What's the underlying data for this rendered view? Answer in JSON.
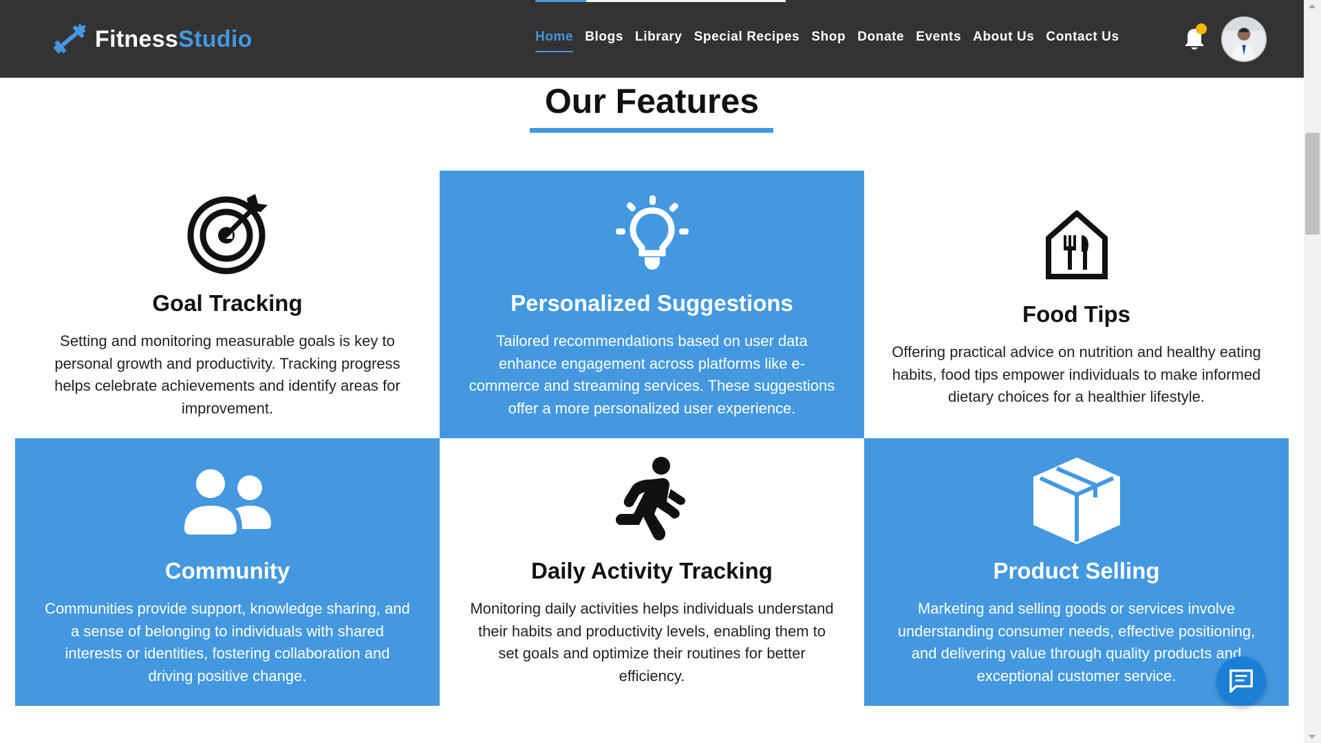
{
  "brand": {
    "name_part1": "Fitness",
    "name_part2": "Studio"
  },
  "nav": {
    "items": [
      {
        "label": "Home",
        "active": true
      },
      {
        "label": "Blogs"
      },
      {
        "label": "Library"
      },
      {
        "label": "Special Recipes"
      },
      {
        "label": "Shop"
      },
      {
        "label": "Donate"
      },
      {
        "label": "Events"
      },
      {
        "label": "About Us"
      },
      {
        "label": "Contact Us"
      }
    ]
  },
  "section": {
    "title": "Our Features"
  },
  "features": [
    {
      "title": "Goal Tracking",
      "text": "Setting and monitoring measurable goals is key to personal growth and productivity. Tracking progress helps celebrate achievements and identify areas for improvement.",
      "icon": "target-icon"
    },
    {
      "title": "Personalized Suggestions",
      "text": "Tailored recommendations based on user data enhance engagement across platforms like e-commerce and streaming services. These suggestions offer a more personalized user experience.",
      "icon": "lightbulb-icon"
    },
    {
      "title": "Food Tips",
      "text": "Offering practical advice on nutrition and healthy eating habits, food tips empower individuals to make informed dietary choices for a healthier lifestyle.",
      "icon": "restaurant-house-icon"
    },
    {
      "title": "Community",
      "text": "Communities provide support, knowledge sharing, and a sense of belonging to individuals with shared interests or identities, fostering collaboration and driving positive change.",
      "icon": "users-icon"
    },
    {
      "title": "Daily Activity Tracking",
      "text": "Monitoring daily activities helps individuals understand their habits and productivity levels, enabling them to set goals and optimize their routines for better efficiency.",
      "icon": "running-person-icon"
    },
    {
      "title": "Product Selling",
      "text": "Marketing and selling goods or services involve understanding consumer needs, effective positioning, and delivering value through quality products and exceptional customer service.",
      "icon": "box-icon"
    }
  ],
  "colors": {
    "accent": "#4398e0",
    "navbar_bg": "#333333",
    "notification_dot": "#f5b800",
    "chat_button": "#1c7fd6"
  }
}
